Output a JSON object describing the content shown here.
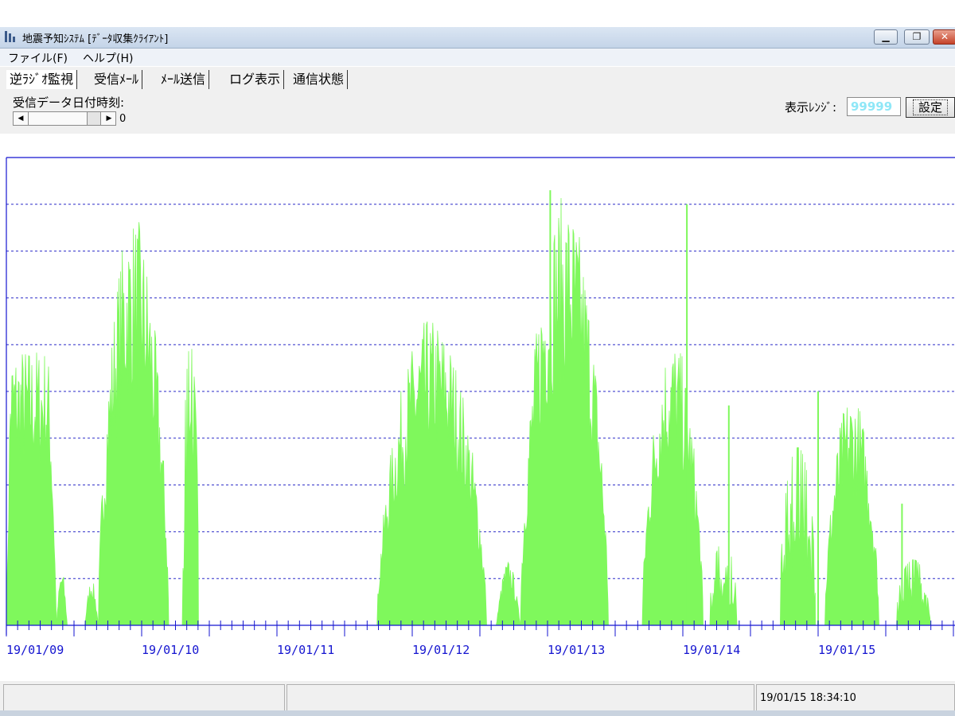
{
  "window": {
    "title": "地震予知ｼｽﾃﾑ [ﾃﾞｰﾀ収集ｸﾗｲｱﾝﾄ]",
    "icon": "app-seismograph-icon",
    "controls": [
      "minimize-icon",
      "restore-icon",
      "close-icon"
    ]
  },
  "menu": {
    "items": [
      {
        "label": "ファイル(F)"
      },
      {
        "label": "ヘルプ(H)"
      }
    ]
  },
  "tabs": [
    {
      "label": "逆ﾗｼﾞｵ監視",
      "active": true
    },
    {
      "label": "受信ﾒｰﾙ",
      "active": false
    },
    {
      "label": "ﾒｰﾙ送信",
      "active": false
    },
    {
      "label": "ログ表示",
      "active": false
    },
    {
      "label": "通信状態",
      "active": false
    }
  ],
  "toolbar": {
    "recv_label": "受信データ日付時刻:",
    "scroll_value": "0",
    "range_label": "表示ﾚﾝｼﾞ:",
    "range_value": "99999",
    "set_label": "設定"
  },
  "colors": {
    "bar": "#7ff85c",
    "axis": "#1515d0",
    "grid": "#2a2ac8"
  },
  "chart_data": {
    "type": "bar",
    "x_tick_labels": [
      "19/01/09",
      "19/01/10",
      "19/01/11",
      "19/01/12",
      "19/01/13",
      "19/01/14",
      "19/01/15"
    ],
    "grid": true,
    "gridline_count": 9,
    "ylim": [
      0,
      99999
    ],
    "xlim_days": [
      0,
      7
    ],
    "xlabel": "",
    "ylabel": "",
    "segments": [
      {
        "start": 0.0,
        "end": 0.37,
        "peak": 60000,
        "shape": "plateau"
      },
      {
        "start": 0.37,
        "end": 0.45,
        "peak": 12000,
        "shape": "bump"
      },
      {
        "start": 0.58,
        "end": 0.68,
        "peak": 10000,
        "shape": "bump"
      },
      {
        "start": 0.68,
        "end": 1.2,
        "peak": 88000,
        "shape": "hump"
      },
      {
        "start": 1.3,
        "end": 1.42,
        "peak": 60000,
        "shape": "spiky"
      },
      {
        "start": 2.74,
        "end": 3.55,
        "peak": 66000,
        "shape": "hump"
      },
      {
        "start": 3.62,
        "end": 3.8,
        "peak": 14000,
        "shape": "bump"
      },
      {
        "start": 3.8,
        "end": 4.45,
        "peak": 92000,
        "shape": "hump"
      },
      {
        "start": 4.7,
        "end": 5.15,
        "peak": 62000,
        "shape": "hump"
      },
      {
        "start": 5.2,
        "end": 5.4,
        "peak": 18000,
        "shape": "spiky"
      },
      {
        "start": 5.72,
        "end": 5.98,
        "peak": 38000,
        "shape": "spiky"
      },
      {
        "start": 6.05,
        "end": 6.45,
        "peak": 50000,
        "shape": "hump"
      },
      {
        "start": 6.58,
        "end": 6.83,
        "peak": 14000,
        "shape": "spiky"
      }
    ],
    "spikes": [
      {
        "x": 4.02,
        "value": 93000
      },
      {
        "x": 5.03,
        "value": 90000
      },
      {
        "x": 5.34,
        "value": 47000
      },
      {
        "x": 6.0,
        "value": 50000
      },
      {
        "x": 6.3,
        "value": 30000
      },
      {
        "x": 6.62,
        "value": 26000
      }
    ]
  },
  "status": {
    "datetime": "19/01/15 18:34:10"
  }
}
